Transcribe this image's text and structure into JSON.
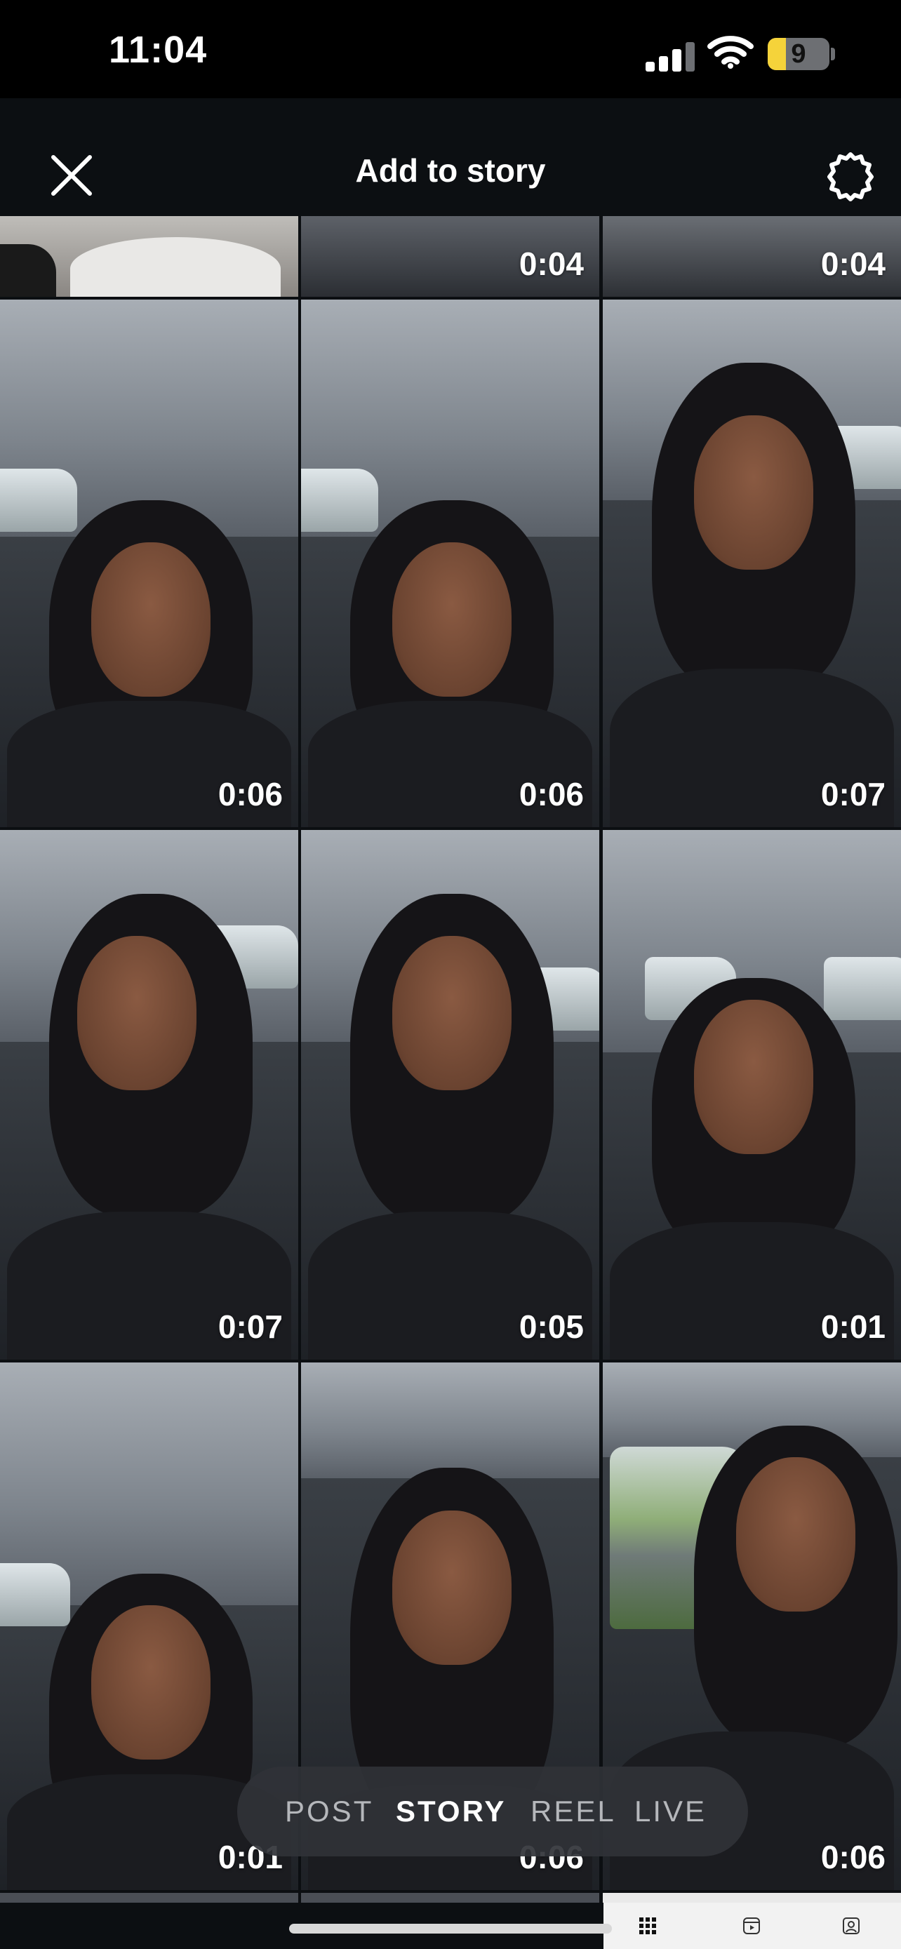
{
  "status_bar": {
    "time": "11:04",
    "battery_level": "9",
    "battery_fraction": 0.3
  },
  "header": {
    "title": "Add to story"
  },
  "icons": {
    "close": "close-icon",
    "settings": "settings-icon",
    "signal": "cellular-signal-icon",
    "wifi": "wifi-icon",
    "battery": "battery-icon"
  },
  "grid": {
    "rows": [
      {
        "durations": [
          "",
          "0:04",
          "0:04"
        ]
      },
      {
        "durations": [
          "0:06",
          "0:06",
          "0:07"
        ]
      },
      {
        "durations": [
          "0:07",
          "0:05",
          "0:01"
        ]
      },
      {
        "durations": [
          "0:01",
          "0:06",
          "0:06"
        ]
      }
    ]
  },
  "modes": {
    "post": "POST",
    "story": "STORY",
    "reel": "REEL",
    "live": "LIVE",
    "active": "STORY"
  },
  "bottom_tabs": [
    "grid-icon",
    "reels-icon",
    "tagged-icon"
  ]
}
